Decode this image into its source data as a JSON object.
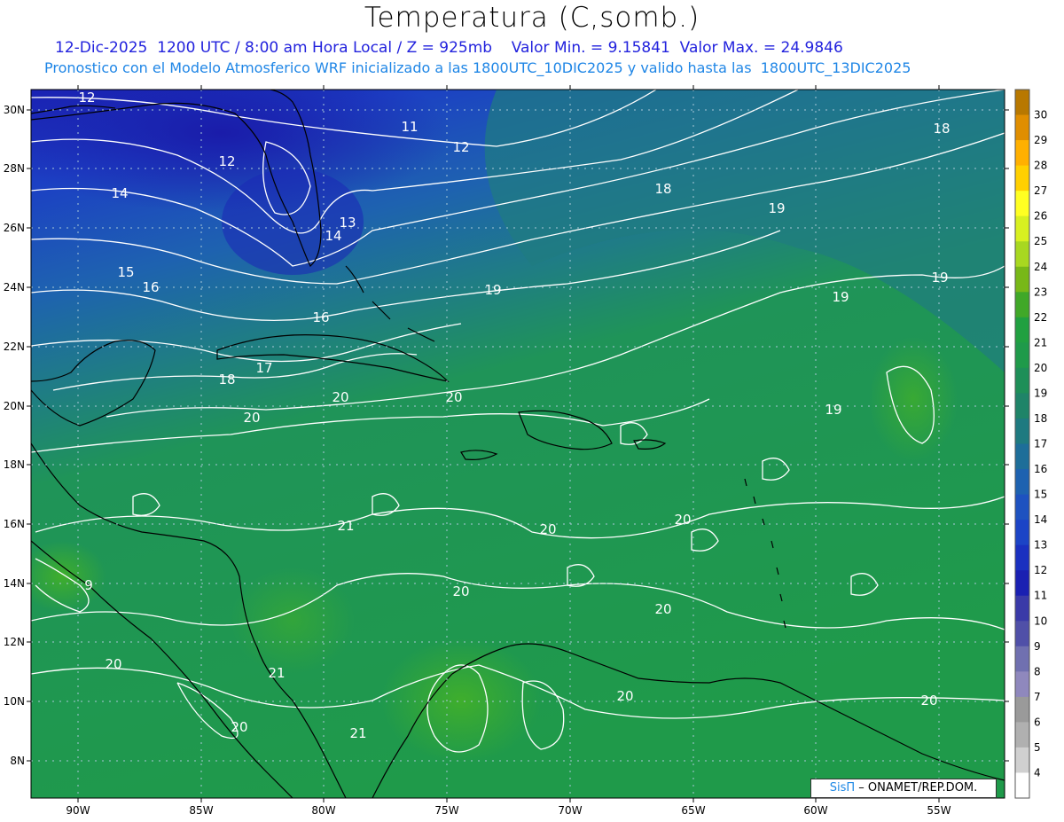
{
  "header": {
    "title": "Temperatura (C,somb.)",
    "line1": "12-Dic-2025  1200 UTC / 8:00 am Hora Local / Z = 925mb    Valor Min. = 9.15841  Valor Max. = 24.9846",
    "line2": "Pronostico con el Modelo Atmosferico WRF inicializado a las 1800UTC_10DIC2025 y valido hasta las  1800UTC_13DIC2025"
  },
  "colors": {
    "accent_blue": "#2222dd",
    "subtitle_blue": "#1f86e6",
    "coast": "#000000",
    "contour": "#ffffff"
  },
  "axes": {
    "lat_labels": [
      "30N",
      "28N",
      "26N",
      "24N",
      "22N",
      "20N",
      "18N",
      "16N",
      "14N",
      "12N",
      "10N",
      "8N"
    ],
    "lon_labels": [
      "90W",
      "85W",
      "80W",
      "75W",
      "70W",
      "65W",
      "60W",
      "55W"
    ]
  },
  "colorbar": {
    "labels": [
      "30",
      "29",
      "28",
      "27",
      "26",
      "25",
      "24",
      "23",
      "22",
      "21",
      "20",
      "19",
      "18",
      "17",
      "16",
      "15",
      "14",
      "13",
      "12",
      "11",
      "10",
      "9",
      "8",
      "7",
      "6",
      "5",
      "4"
    ],
    "colors": [
      "#b87800",
      "#e08e00",
      "#ffb000",
      "#ffd000",
      "#ffff22",
      "#d8f020",
      "#a8d820",
      "#78b818",
      "#40a828",
      "#20a040",
      "#1f9a4a",
      "#1e8f58",
      "#1f8468",
      "#1f7a80",
      "#1e6e99",
      "#1e62b0",
      "#1e52c0",
      "#1c44c6",
      "#1a30c0",
      "#1a20b2",
      "#3a3aa8",
      "#5050a8",
      "#7070b0",
      "#8f88bd",
      "#9a9a9a",
      "#b0b0b0",
      "#d0d0d0",
      "#ffffff"
    ]
  },
  "isotherm_labels": [
    {
      "text": "12"
    },
    {
      "text": "11"
    },
    {
      "text": "12"
    },
    {
      "text": "12"
    },
    {
      "text": "14"
    },
    {
      "text": "13"
    },
    {
      "text": "14"
    },
    {
      "text": "15"
    },
    {
      "text": "16"
    },
    {
      "text": "16"
    },
    {
      "text": "18"
    },
    {
      "text": "18"
    },
    {
      "text": "17"
    },
    {
      "text": "19"
    },
    {
      "text": "19"
    },
    {
      "text": "19"
    },
    {
      "text": "19"
    },
    {
      "text": "20"
    },
    {
      "text": "20"
    },
    {
      "text": "20"
    },
    {
      "text": "21"
    },
    {
      "text": "20"
    },
    {
      "text": "20"
    },
    {
      "text": "20"
    },
    {
      "text": "20"
    },
    {
      "text": "9"
    },
    {
      "text": "20"
    },
    {
      "text": "21"
    },
    {
      "text": "20"
    },
    {
      "text": "21"
    },
    {
      "text": "20"
    },
    {
      "text": "20"
    },
    {
      "text": "19"
    },
    {
      "text": "18"
    }
  ],
  "footer": {
    "brand": "SisΠ",
    "credit": " – ONAMET/REP.DOM."
  }
}
